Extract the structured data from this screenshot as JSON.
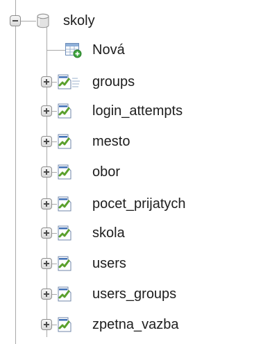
{
  "database": {
    "name": "skoly",
    "icon": "database-icon",
    "expander": "collapse-minus-icon"
  },
  "new_item": {
    "label": "Nová",
    "icon": "new-table-icon"
  },
  "tables": [
    {
      "label": "groups",
      "icon": "table-icon",
      "expander": "expand-plus-icon"
    },
    {
      "label": "login_attempts",
      "icon": "table-icon",
      "expander": "expand-plus-icon"
    },
    {
      "label": "mesto",
      "icon": "table-icon",
      "expander": "expand-plus-icon"
    },
    {
      "label": "obor",
      "icon": "table-icon",
      "expander": "expand-plus-icon"
    },
    {
      "label": "pocet_prijatych",
      "icon": "table-icon",
      "expander": "expand-plus-icon"
    },
    {
      "label": "skola",
      "icon": "table-icon",
      "expander": "expand-plus-icon"
    },
    {
      "label": "users",
      "icon": "table-icon",
      "expander": "expand-plus-icon"
    },
    {
      "label": "users_groups",
      "icon": "table-icon",
      "expander": "expand-plus-icon"
    },
    {
      "label": "zpetna_vazba",
      "icon": "table-icon",
      "expander": "expand-plus-icon"
    }
  ],
  "colors": {
    "tree_line": "#a8a8a8",
    "table_icon_green": "#5aa02c",
    "table_icon_blue": "#3f6fb5",
    "new_badge_green": "#3da53d"
  }
}
